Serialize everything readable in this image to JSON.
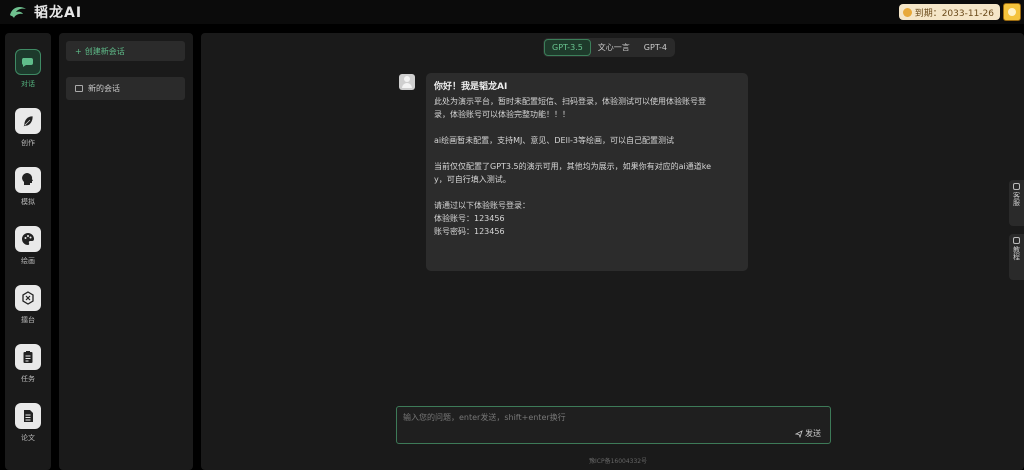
{
  "app": {
    "name": "韬龙AI"
  },
  "header": {
    "expire_label": "到期：2033-11-26"
  },
  "nav": {
    "items": [
      {
        "label": "对话",
        "icon": "chat-bubble-icon",
        "active": true
      },
      {
        "label": "创作",
        "icon": "feather-icon",
        "active": false
      },
      {
        "label": "模拟",
        "icon": "head-icon",
        "active": false
      },
      {
        "label": "绘画",
        "icon": "palette-icon",
        "active": false
      },
      {
        "label": "擂台",
        "icon": "arena-icon",
        "active": false
      },
      {
        "label": "任务",
        "icon": "clipboard-icon",
        "active": false
      },
      {
        "label": "论文",
        "icon": "document-icon",
        "active": false
      }
    ]
  },
  "sessions": {
    "new_label": "创建新会话",
    "items": [
      {
        "label": "新的会话"
      }
    ]
  },
  "models": {
    "tabs": [
      {
        "label": "GPT-3.5",
        "active": true
      },
      {
        "label": "文心一言",
        "active": false
      },
      {
        "label": "GPT-4",
        "active": false
      }
    ]
  },
  "message": {
    "title": "你好！我是韬龙AI",
    "lines": [
      "此处为演示平台，暂时未配置短信、扫码登录，体验测试可以使用体验账号登",
      "录，体验账号可以体验完整功能！！！",
      "",
      "ai绘画暂未配置，支持MJ、意见、DEll-3等绘画，可以自己配置测试",
      "",
      "当前仅仅配置了GPT3.5的演示可用，其他均为展示，如果你有对应的ai通道ke",
      "y，可自行填入测试。",
      "",
      "请通过以下体验账号登录：",
      "体验账号：123456",
      "账号密码：123456"
    ]
  },
  "side_tabs": [
    {
      "label": "客服"
    },
    {
      "label": "教程"
    }
  ],
  "input": {
    "placeholder": "输入您的问题，enter发送，shift+enter换行",
    "send_label": "发送"
  },
  "footer": {
    "icp": "豫ICP备16004332号"
  },
  "colors": {
    "accent": "#54b37e",
    "background": "#000000",
    "panel": "#1a1a1a"
  }
}
